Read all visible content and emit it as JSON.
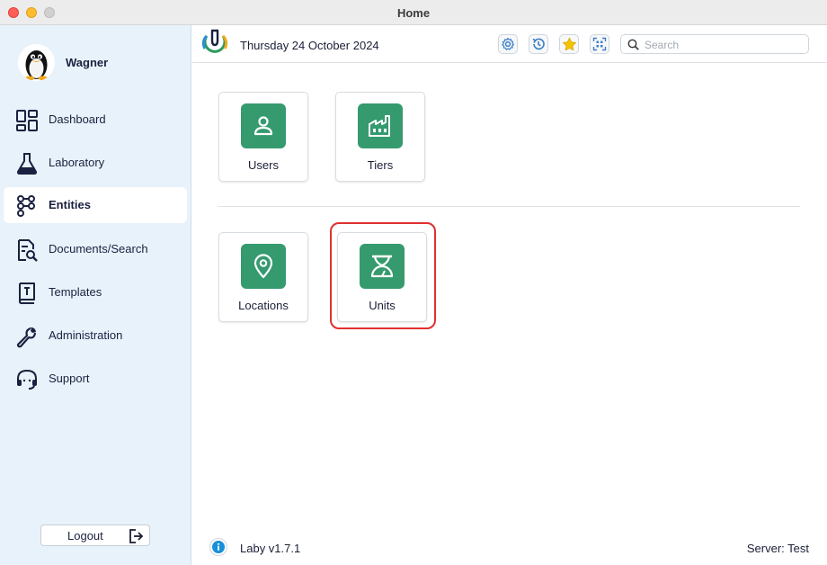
{
  "window": {
    "title": "Home"
  },
  "sidebar": {
    "user": {
      "name": "Wagner"
    },
    "items": [
      {
        "label": "Dashboard",
        "icon": "dashboard-icon",
        "active": false
      },
      {
        "label": "Laboratory",
        "icon": "flask-icon",
        "active": false
      },
      {
        "label": "Entities",
        "icon": "entities-icon",
        "active": true
      },
      {
        "label": "Documents/Search",
        "icon": "document-search-icon",
        "active": false
      },
      {
        "label": "Templates",
        "icon": "template-book-icon",
        "active": false
      },
      {
        "label": "Administration",
        "icon": "wrench-icon",
        "active": false
      },
      {
        "label": "Support",
        "icon": "headset-icon",
        "active": false
      }
    ],
    "logout_label": "Logout"
  },
  "header": {
    "date": "Thursday 24 October 2024",
    "tools": [
      "settings-icon",
      "history-icon",
      "favorites-star-icon",
      "scan-icon"
    ],
    "search": {
      "placeholder": "Search",
      "value": ""
    }
  },
  "main": {
    "tiles": [
      {
        "label": "Users",
        "icon": "user-icon"
      },
      {
        "label": "Tiers",
        "icon": "factory-icon"
      },
      {
        "label": "Locations",
        "icon": "location-pin-icon"
      },
      {
        "label": "Units",
        "icon": "scale-icon"
      }
    ]
  },
  "footer": {
    "version": "Laby v1.7.1",
    "server": "Server: Test"
  },
  "colors": {
    "accent": "#359a6e",
    "sidebar_bg": "#e8f2fa",
    "highlight": "#e03030",
    "nav_icon": "#1a2140"
  }
}
